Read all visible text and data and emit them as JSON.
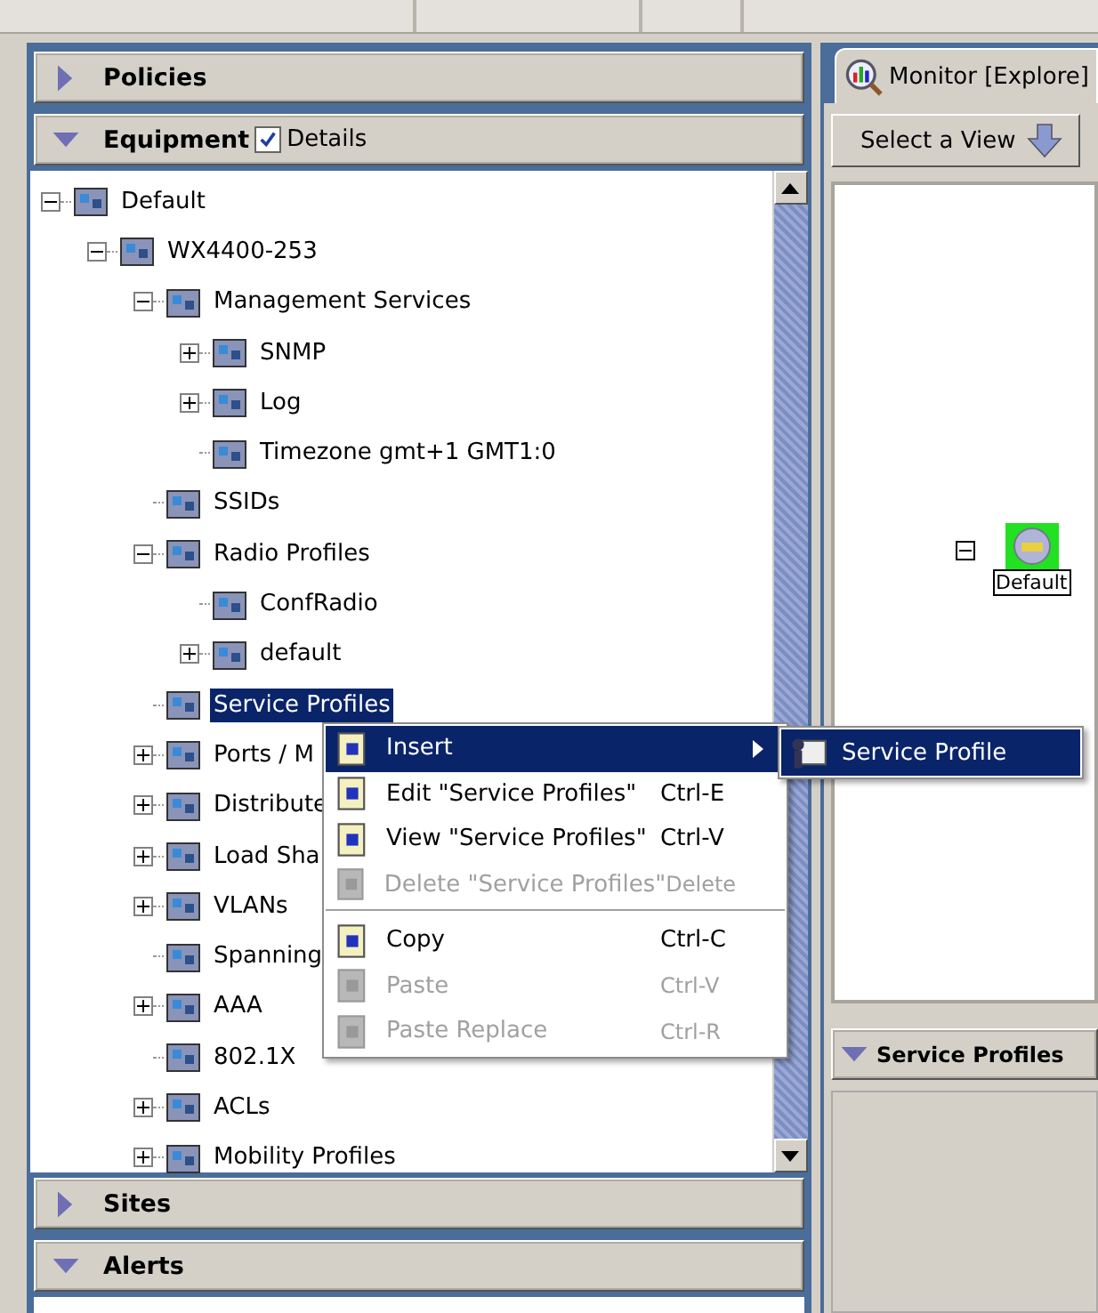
{
  "left_sections": [
    {
      "label": "Policies",
      "expanded": false
    },
    {
      "label": "Equipment",
      "expanded": true,
      "details": {
        "label": "Details",
        "checked": true
      },
      "tree": [
        {
          "label": "Default",
          "expanded": true,
          "selected": false,
          "children": [
            {
              "label": "WX4400-253",
              "expanded": true,
              "selected": false,
              "children": [
                {
                  "label": "Management Services",
                  "expanded": true,
                  "selected": false,
                  "children": [
                    {
                      "label": "SNMP",
                      "expanded": false,
                      "selected": false
                    },
                    {
                      "label": "Log",
                      "expanded": false,
                      "selected": false
                    },
                    {
                      "label": "Timezone gmt+1 GMT1:0",
                      "selected": false
                    }
                  ]
                },
                {
                  "label": "SSIDs",
                  "selected": false
                },
                {
                  "label": "Radio Profiles",
                  "expanded": true,
                  "selected": false,
                  "children": [
                    {
                      "label": "ConfRadio",
                      "selected": false
                    },
                    {
                      "label": "default",
                      "expanded": false,
                      "selected": false
                    }
                  ]
                },
                {
                  "label": "Service Profiles",
                  "selected": true
                },
                {
                  "label": "Ports / M",
                  "expanded": false,
                  "selected": false
                },
                {
                  "label": "Distribute",
                  "expanded": false,
                  "selected": false
                },
                {
                  "label": "Load Sha",
                  "expanded": false,
                  "selected": false
                },
                {
                  "label": "VLANs",
                  "expanded": false,
                  "selected": false
                },
                {
                  "label": "Spanning",
                  "selected": false
                },
                {
                  "label": "AAA",
                  "expanded": false,
                  "selected": false
                },
                {
                  "label": "802.1X",
                  "selected": false
                },
                {
                  "label": "ACLs",
                  "expanded": false,
                  "selected": false
                },
                {
                  "label": "Mobility Profiles",
                  "expanded": false,
                  "selected": false
                }
              ]
            }
          ]
        }
      ]
    },
    {
      "label": "Sites",
      "expanded": false
    },
    {
      "label": "Alerts",
      "expanded": true
    }
  ],
  "context_menu": [
    {
      "kind": "item",
      "label": "Insert",
      "selected": true,
      "disabled": false,
      "submenu": true
    },
    {
      "kind": "item",
      "label": "Edit \"Service Profiles\"",
      "shortcut": "Ctrl-E",
      "selected": false,
      "disabled": false
    },
    {
      "kind": "item",
      "label": "View \"Service Profiles\"",
      "shortcut": "Ctrl-V",
      "selected": false,
      "disabled": false
    },
    {
      "kind": "item",
      "label": "Delete \"Service Profiles\"",
      "shortcut": "Delete",
      "selected": false,
      "disabled": true
    },
    {
      "kind": "separator"
    },
    {
      "kind": "item",
      "label": "Copy",
      "shortcut": "Ctrl-C",
      "selected": false,
      "disabled": false
    },
    {
      "kind": "item",
      "label": "Paste",
      "shortcut": "Ctrl-V",
      "selected": false,
      "disabled": true
    },
    {
      "kind": "item",
      "label": "Paste Replace",
      "shortcut": "Ctrl-R",
      "selected": false,
      "disabled": true
    }
  ],
  "submenu": [
    {
      "label": "Service Profile",
      "selected": true
    }
  ],
  "right_panel": {
    "tab": {
      "label": "Monitor [Explore]",
      "selected": true
    },
    "view_button": "Select a View",
    "canvas_node": {
      "label": "Default",
      "expanded": true
    },
    "bottom_section": {
      "label": "Service Profiles",
      "expanded": true
    }
  }
}
